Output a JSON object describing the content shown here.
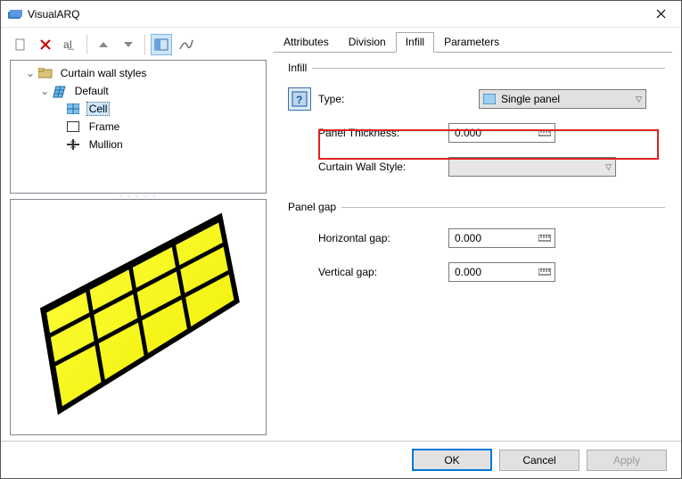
{
  "window": {
    "title": "VisualARQ"
  },
  "toolbar": {
    "icons": [
      "new",
      "delete",
      "redefine",
      "up",
      "down",
      "sep",
      "viewtoggle",
      "curve"
    ]
  },
  "tree": {
    "root": {
      "label": "Curtain wall styles",
      "children": [
        {
          "label": "Default",
          "children": [
            {
              "label": "Cell",
              "selected": true
            },
            {
              "label": "Frame"
            },
            {
              "label": "Mullion"
            }
          ]
        }
      ]
    }
  },
  "tabs": {
    "items": [
      "Attributes",
      "Division",
      "Infill",
      "Parameters"
    ],
    "active": 2
  },
  "infill": {
    "group_label": "Infill",
    "type_label": "Type:",
    "type_value": "Single panel",
    "thickness_label": "Panel Thickness:",
    "thickness_value": "0.000",
    "style_label": "Curtain Wall Style:"
  },
  "panelgap": {
    "group_label": "Panel gap",
    "hgap_label": "Horizontal gap:",
    "hgap_value": "0.000",
    "vgap_label": "Vertical gap:",
    "vgap_value": "0.000"
  },
  "footer": {
    "ok": "OK",
    "cancel": "Cancel",
    "apply": "Apply"
  }
}
